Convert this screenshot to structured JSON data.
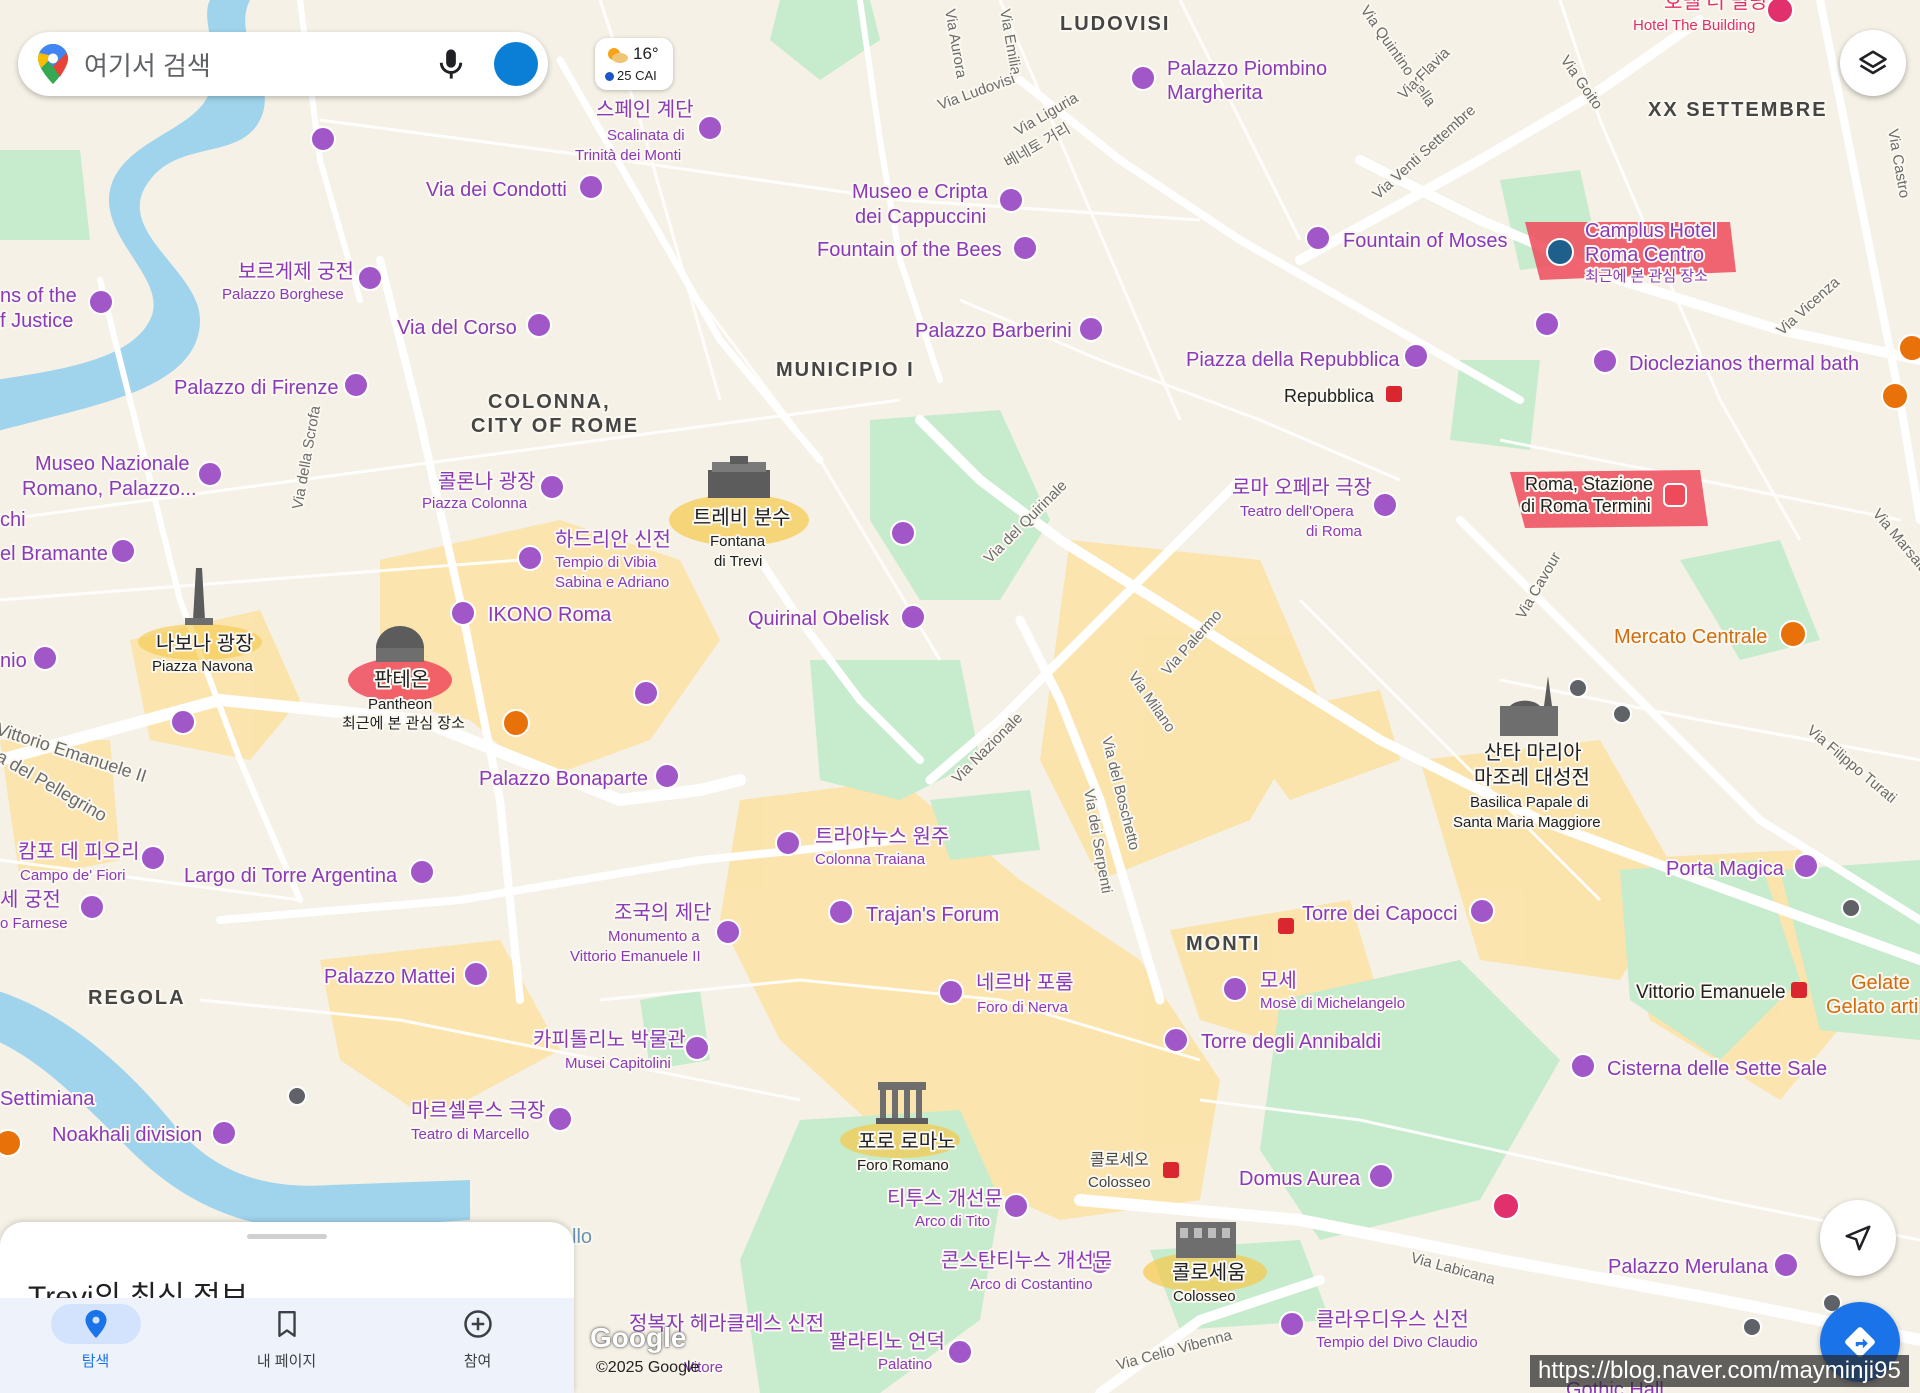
{
  "search": {
    "placeholder": "여기서 검색"
  },
  "weather": {
    "temp": "16°",
    "aqi": "25 CAI"
  },
  "districts": [
    "LUDOVISI",
    "XX SETTEMBRE",
    "MUNICIPIO I",
    "COLONNA,",
    "CITY OF ROME",
    "MONTI",
    "REGOLA"
  ],
  "streets": [
    "Via Aurora",
    "Via Emilia",
    "Via Ludovisi",
    "Via Liguria",
    "베네토 거리",
    "Via Quintino Sella",
    "Via Flavia",
    "Via Goito",
    "Via Venti Settembre",
    "Via Vicenza",
    "Via del Quirinale",
    "Via Palermo",
    "Via Milano",
    "Via Nazionale",
    "Via del Boschetto",
    "Via dei Serpenti",
    "Via Cavour",
    "Via Filippo Turati",
    "Via Marsala",
    "Via della Scrofa",
    "Vittorio Emanuele II",
    "Via Labicana",
    "Via Celio Vibenna",
    "Via Castro"
  ],
  "pois": [
    {
      "name": "스페인 계단",
      "sub1": "Scalinata di",
      "sub2": "Trinità dei Monti"
    },
    {
      "name": "Via dei Condotti"
    },
    {
      "name": "보르게제 궁전",
      "sub1": "Palazzo Borghese"
    },
    {
      "name": "Via del Corso"
    },
    {
      "name": "Palazzo di Firenze"
    },
    {
      "name": "Museo Nazionale",
      "sub1": "Romano, Palazzo..."
    },
    {
      "name": "콜론나 광장",
      "sub1": "Piazza Colonna"
    },
    {
      "name": "하드리안 신전",
      "sub1": "Tempio di Vibia",
      "sub2": "Sabina e Adriano"
    },
    {
      "name": "IKONO Roma"
    },
    {
      "name": "트레비 분수",
      "sub1": "Fontana",
      "sub2": "di Trevi"
    },
    {
      "name": "나보나 광장",
      "sub1": "Piazza Navona"
    },
    {
      "name": "판테온",
      "sub1": "Pantheon",
      "sub2": "최근에 본 관심 장소"
    },
    {
      "name": "Palazzo Bonaparte"
    },
    {
      "name": "캄포 데 피오리",
      "sub1": "Campo de' Fiori"
    },
    {
      "name": "Largo di Torre Argentina"
    },
    {
      "name": "세 궁전",
      "sub1": "o Farnese"
    },
    {
      "name": "Palazzo Mattei"
    },
    {
      "name": "조국의 제단",
      "sub1": "Monumento a",
      "sub2": "Vittorio Emanuele II"
    },
    {
      "name": "트라야누스 원주",
      "sub1": "Colonna Traiana"
    },
    {
      "name": "Trajan's Forum"
    },
    {
      "name": "카피톨리노 박물관",
      "sub1": "Musei Capitolini"
    },
    {
      "name": "마르셀루스 극장",
      "sub1": "Teatro di Marcello"
    },
    {
      "name": "Noakhali division"
    },
    {
      "name": "Settimiana"
    },
    {
      "name": "포로 로마노",
      "sub1": "Foro Romano"
    },
    {
      "name": "티투스 개선문",
      "sub1": "Arco di Tito"
    },
    {
      "name": "콘스탄티누스 개선문",
      "sub1": "Arco di Costantino"
    },
    {
      "name": "콜로세움",
      "sub1": "Colosseo"
    },
    {
      "name": "팔라티노 언덕",
      "sub1": "Palatino"
    },
    {
      "name": "정복자 헤라클레스 신전"
    },
    {
      "name": "네르바 포룸",
      "sub1": "Foro di Nerva"
    },
    {
      "name": "모세",
      "sub1": "Mosè di Michelangelo"
    },
    {
      "name": "Torre degli Annibaldi"
    },
    {
      "name": "Domus Aurea"
    },
    {
      "name": "클라우디우스 신전",
      "sub1": "Tempio del Divo Claudio"
    },
    {
      "name": "Palazzo Merulana"
    },
    {
      "name": "Quirinal Obelisk"
    },
    {
      "name": "Palazzo Piombino",
      "sub1": "Margherita"
    },
    {
      "name": "Museo e Cripta",
      "sub1": "dei Cappuccini"
    },
    {
      "name": "Fountain of the Bees"
    },
    {
      "name": "Palazzo Barberini"
    },
    {
      "name": "Fountain of Moses"
    },
    {
      "name": "Piazza della Repubblica"
    },
    {
      "name": "로마 오페라 극장",
      "sub1": "Teatro dell'Opera",
      "sub2": "di Roma"
    },
    {
      "name": "Dioclezianos thermal bath"
    },
    {
      "name": "산타 마리아",
      "sub1": "마조레 대성전",
      "sub2": "Basilica Papale di",
      "sub3": "Santa Maria Maggiore"
    },
    {
      "name": "Porta Magica"
    },
    {
      "name": "Torre dei Capocci"
    },
    {
      "name": "Cisterna delle Sette Sale"
    },
    {
      "name": "Vittorio Emanuele"
    },
    {
      "name": "Gelato arti"
    },
    {
      "name": "Gelate"
    },
    {
      "name": "ns of the"
    },
    {
      "name": "f Justice"
    },
    {
      "name": "el Bramante"
    },
    {
      "name": "chi"
    },
    {
      "name": "nio"
    },
    {
      "name": "Vittorio Emanuele II"
    },
    {
      "name": "a del Pellegrino"
    }
  ],
  "saved": [
    {
      "name": "Camplus Hotel",
      "sub1": "Roma Centro",
      "sub2": "최근에 본 관심 장소"
    },
    {
      "name": "Roma, Stazione",
      "sub1": "di Roma Termini"
    },
    {
      "name": "Hotel The Building",
      "top": "호텔 더 빌딩"
    }
  ],
  "food": [
    "Mercato Centrale"
  ],
  "transit": [
    "Repubblica",
    "Colosseo",
    "콜로세오"
  ],
  "river_label": "llo",
  "gothic": "Gothic Hall",
  "trajan_partial": "Vitore",
  "sheet": {
    "title": "Trevi의 최신 정보"
  },
  "nav": [
    {
      "label": "탐색",
      "icon": "pin-icon",
      "active": true
    },
    {
      "label": "내 페이지",
      "icon": "bookmark-icon",
      "active": false
    },
    {
      "label": "참여",
      "icon": "add-circle-icon",
      "active": false
    }
  ],
  "watermark": "https://blog.naver.com/mayminji95",
  "google": "Google",
  "copyright": "©2025 Google",
  "colors": {
    "poi": "#8a3ab9",
    "highlight_red": "#ef4a5a",
    "highlight_yellow": "#f7c948",
    "water": "#9fd4ec",
    "park": "#c7ebcd",
    "accent": "#1a73e8"
  }
}
